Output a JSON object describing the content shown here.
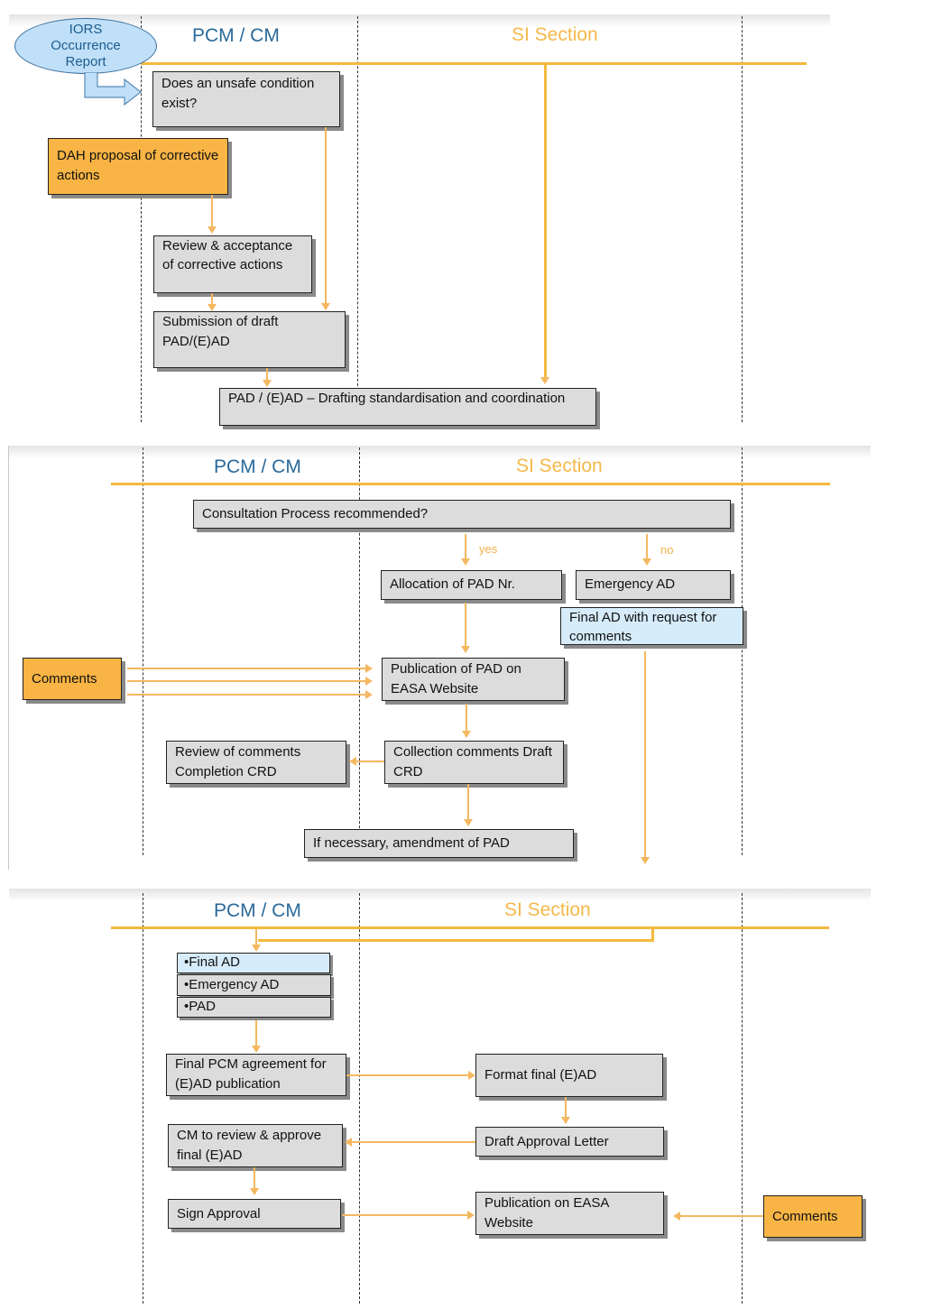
{
  "colors": {
    "accent_line": "#f4b93c",
    "pcm_title": "#2a6a9a",
    "si_title": "#f5b84a",
    "box_grey": "#dcdcdc",
    "box_orange": "#f8b444",
    "box_blue": "#d6ecfb",
    "oval_fill": "#bfe0f8"
  },
  "lanes": {
    "pcm": "PCM / CM",
    "si": "SI Section"
  },
  "panel1": {
    "oval": [
      "IORS",
      "Occurrence",
      "Report"
    ],
    "unsafe_condition": "Does an unsafe condition exist?",
    "dah_proposal": "DAH proposal of corrective actions",
    "review_acceptance": "Review & acceptance of corrective actions",
    "submission": "Submission of draft PAD/(E)AD",
    "drafting": "PAD / (E)AD – Drafting standardisation and coordination"
  },
  "panel2": {
    "consultation": "Consultation Process recommended?",
    "yes": "yes",
    "no": "no",
    "allocation": "Allocation of PAD Nr.",
    "emergency_ad": "Emergency AD",
    "final_ad_request": "Final AD with request for comments",
    "comments": "Comments",
    "publication_pad": "Publication of PAD on EASA Website",
    "review_comments": "Review of comments Completion CRD",
    "collection_comments": "Collection comments Draft CRD",
    "amendment": "If necessary, amendment of PAD"
  },
  "panel3": {
    "list": [
      "•Final AD",
      "•Emergency AD",
      "•PAD"
    ],
    "final_pcm": "Final PCM agreement for (E)AD publication",
    "format_final": "Format final (E)AD",
    "cm_review": "CM to review & approve final (E)AD",
    "draft_letter": "Draft Approval Letter",
    "sign_approval": "Sign Approval",
    "publication_easa": "Publication on EASA Website",
    "comments": "Comments"
  }
}
